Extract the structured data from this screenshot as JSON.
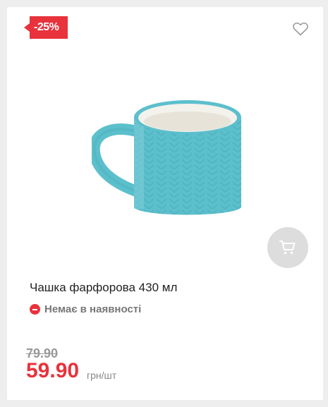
{
  "product": {
    "discount_badge": "-25%",
    "name": "Чашка фарфорова 430 мл",
    "availability": "Немає в наявності",
    "old_price": "79.90",
    "price": "59.90",
    "unit": "грн/шт"
  },
  "icons": {
    "favorite": "heart-outline-icon",
    "cart": "cart-icon",
    "availability": "minus-circle-icon"
  },
  "colors": {
    "accent": "#e8323c",
    "mug": "#5cbfcc",
    "cart_button_bg": "#dddddd"
  }
}
